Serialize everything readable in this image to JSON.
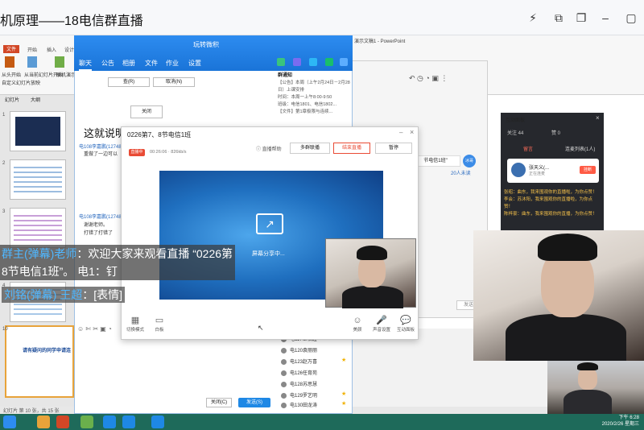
{
  "window": {
    "title": "机原理——18电信群直播"
  },
  "ppt": {
    "app_title": "演示文稿1 - PowerPoint",
    "file_tab": "文件",
    "tabs": [
      "开始",
      "插入",
      "设计"
    ],
    "ribbon_labels": [
      "从头开始",
      "从当前幻灯片开始",
      "联机演示",
      "自定义幻灯片放映",
      "设置幻灯片放映",
      "隐藏幻灯片"
    ],
    "pane_tabs": [
      "幻灯片",
      "大纲"
    ],
    "slide_numbers": [
      "1",
      "2",
      "3",
      "4",
      "5",
      "10"
    ],
    "slide10_text": "请有疑问的同学申请连",
    "status": "幻灯片 第 10 张，共 15 张"
  },
  "qq": {
    "title": "玩转微积",
    "tabs": [
      "聊天",
      "公告",
      "相册",
      "文件",
      "作业",
      "设置"
    ],
    "notice_title": "群通知",
    "notice_lines": [
      "【公告】本周（上午2月24日－2月28日）上课安排",
      "时间：本周一上午8:00-9:50",
      "班级：电信1801、电信1802...",
      "【文件】第1章极限与连续..."
    ],
    "big_text": "这就说明",
    "messages": [
      {
        "name": "电108李嘉鹏(12748...",
        "text": "重做了一边可以"
      },
      {
        "name": "电108李嘉鹏(12748...",
        "text": "谢谢老师。"
      },
      {
        "name": "",
        "text": "打错了打错了"
      }
    ],
    "card_buttons": [
      "查(R)",
      "取消(N)",
      "关闭"
    ],
    "members": [
      "电117王相超",
      "电120袁丽丽",
      "电123赵万喜",
      "电126任育苑",
      "电128苏思慧",
      "电129罗艺明",
      "电130田龙涛",
      "电131..."
    ],
    "close_btn": "关闭(C)",
    "send_btn": "发送(S)"
  },
  "chat2": {
    "bubble": "节电信1班\"",
    "avatar": "冰哥",
    "read": "20人未读",
    "send": "发送"
  },
  "interaction": {
    "title": "互动面板",
    "fav": "关注 44",
    "like": "赞 0",
    "tab_a": "留言",
    "tab_b": "连麦列表(1人)",
    "card_name": "张天义(...",
    "card_sub": "正在连麦",
    "card_btn": "挂断",
    "msgs": [
      "张昭：曲东，我来围观你的直播啦，为你点赞！",
      "李会：苏沐阳，我来围观你的直播啦，为你点赞！",
      "陈梓豪：曲东，我来围观你的直播，为你点赞！"
    ]
  },
  "live": {
    "title": "0226第7、8节电信1班",
    "badge": "直播中",
    "stats": "00:26:06 · 826kb/s",
    "help": "直播帮助",
    "btn_multi": "多群联播",
    "btn_end": "结束直播",
    "btn_pause": "暂停",
    "share_text": "屏幕分享中...",
    "tools": [
      {
        "icon": "▦",
        "label": "切换模式"
      },
      {
        "icon": "▭",
        "label": "白板"
      },
      {
        "icon": "☺",
        "label": "美颜"
      },
      {
        "icon": "🎤",
        "label": "声音设置"
      },
      {
        "icon": "💬",
        "label": "互动面板"
      }
    ]
  },
  "danmaku": {
    "l1_name": "群主(弹幕)老师",
    "l1_text": "：欢迎大家来观看直播 “0226第",
    "l2_text": "8节电信1班”。  电1：钉",
    "l3_name": "刘铭(弹幕) 王超",
    "l3_text": "：[表情]"
  },
  "taskbar": {
    "time": "下午 6:28",
    "date": "2020/2/26 星期三"
  },
  "colors": {
    "qq_blue": "#1a74d8",
    "live_red": "#e94b35",
    "panel_dark": "#26282d",
    "taskbar": "#1e6a5a"
  }
}
